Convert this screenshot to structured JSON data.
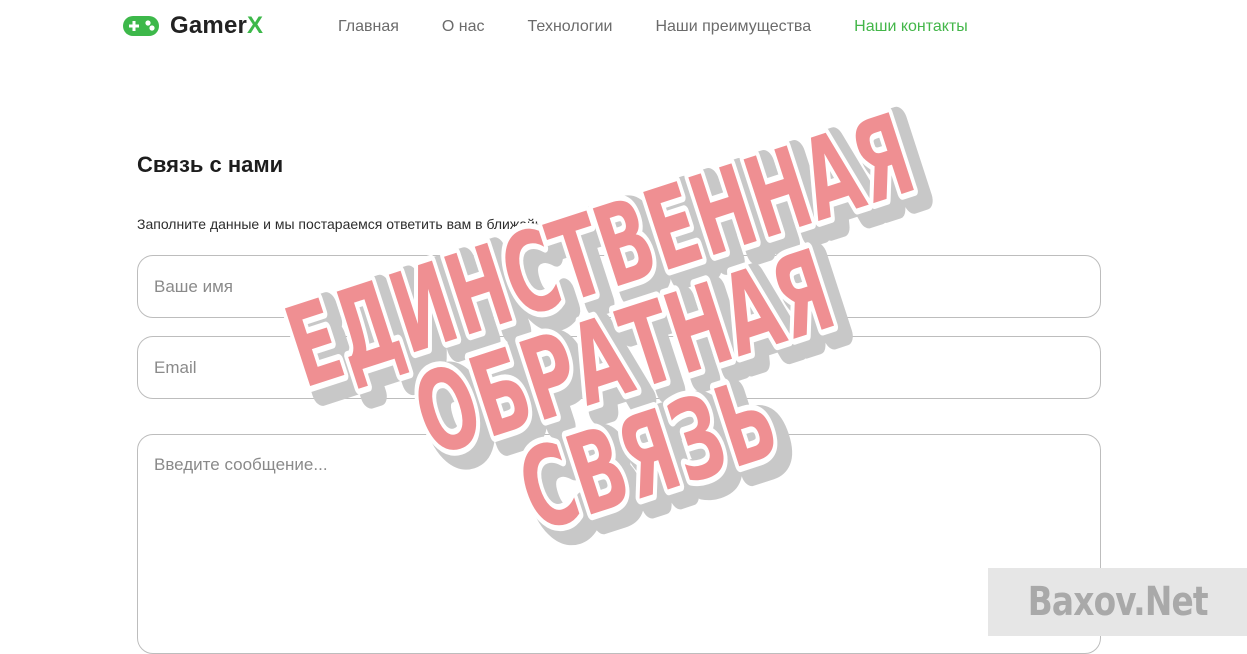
{
  "brand": {
    "name_prefix": "Gamer",
    "name_accent": "X",
    "accent_color": "#3db84a"
  },
  "nav": {
    "items": [
      {
        "label": "Главная"
      },
      {
        "label": "О нас"
      },
      {
        "label": "Технологии"
      },
      {
        "label": "Наши преимущества"
      },
      {
        "label": "Наши контакты",
        "active": true
      }
    ]
  },
  "contact": {
    "title": "Связь с нами",
    "subtitle": "Заполните данные и мы постараемся ответить вам в ближайшие 30 минут.",
    "name_placeholder": "Ваше имя",
    "email_placeholder": "Email",
    "message_placeholder": "Введите сообщение..."
  },
  "overlay": {
    "line1": "ЕДИНСТВЕННАЯ",
    "line2": "ОБРАТНАЯ",
    "line3": "СВЯЗЬ",
    "color": "#ef8f92",
    "outline_color": "#c8c8c8"
  },
  "watermark": {
    "text": "Baxov.Net"
  }
}
